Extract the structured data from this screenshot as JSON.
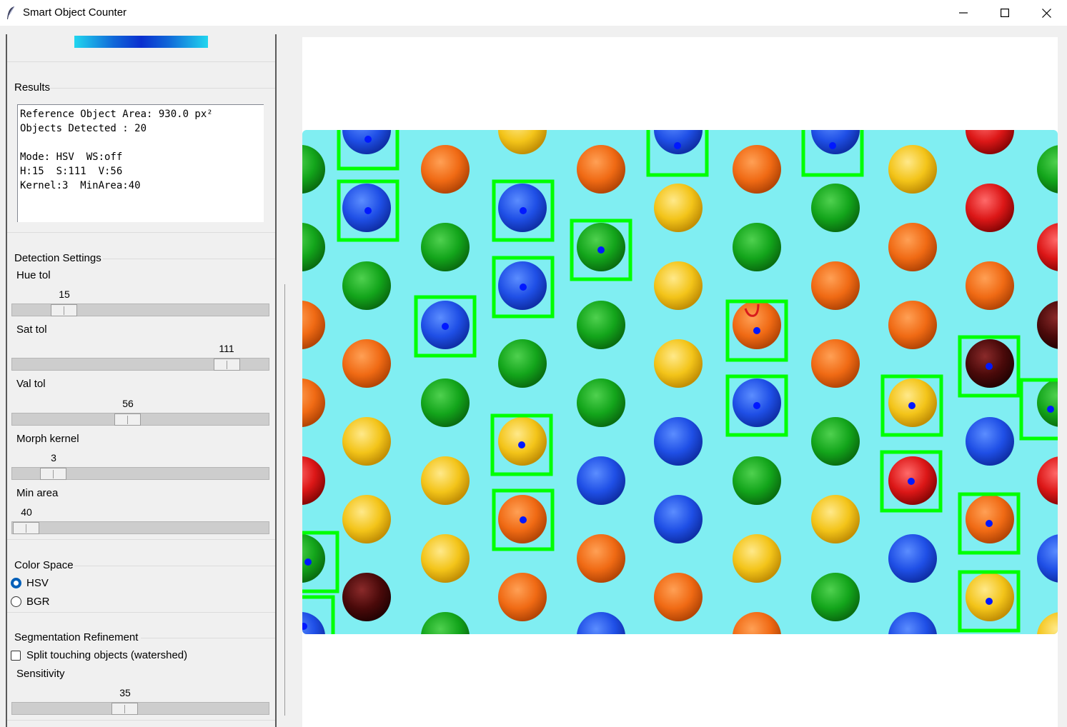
{
  "window": {
    "title": "Smart Object Counter",
    "controls": {
      "minimize": "minimize",
      "maximize": "maximize",
      "close": "close"
    }
  },
  "results": {
    "label": "Results",
    "lines": [
      "Reference Object Area: 930.0 px²",
      "Objects Detected : 20",
      "",
      "Mode: HSV  WS:off",
      "H:15  S:111  V:56",
      "Kernel:3  MinArea:40"
    ]
  },
  "detection": {
    "label": "Detection Settings",
    "sliders": [
      {
        "label": "Hue tol",
        "value": "15",
        "min": 0,
        "max": 180,
        "level": 0.2
      },
      {
        "label": "Sat tol",
        "value": "111",
        "min": 0,
        "max": 255,
        "level": 0.83
      },
      {
        "label": "Val tol",
        "value": "56",
        "min": 0,
        "max": 255,
        "level": 0.47
      },
      {
        "label": "Morph kernel",
        "value": "3",
        "min": 1,
        "max": 31,
        "level": 0.16
      },
      {
        "label": "Min area",
        "value": "40",
        "min": 0,
        "max": 5000,
        "level": 0.0
      }
    ]
  },
  "color_space": {
    "label": "Color Space",
    "options": [
      {
        "label": "HSV",
        "selected": true
      },
      {
        "label": "BGR",
        "selected": false
      }
    ]
  },
  "segmentation": {
    "label": "Segmentation Refinement",
    "watershed_label": "Split touching objects (watershed)",
    "watershed_checked": false,
    "sensitivity_label": "Sensitivity",
    "sensitivity_value": "35",
    "sensitivity_level": 0.42
  },
  "colors": {
    "accent": "#005fb8",
    "detection_box": "#00ff00",
    "background_candy": "#80eef2",
    "gradient_mid": "#0a2fcf"
  },
  "icons": [
    "feather-icon",
    "minimize-icon",
    "maximize-icon",
    "close-icon"
  ]
}
